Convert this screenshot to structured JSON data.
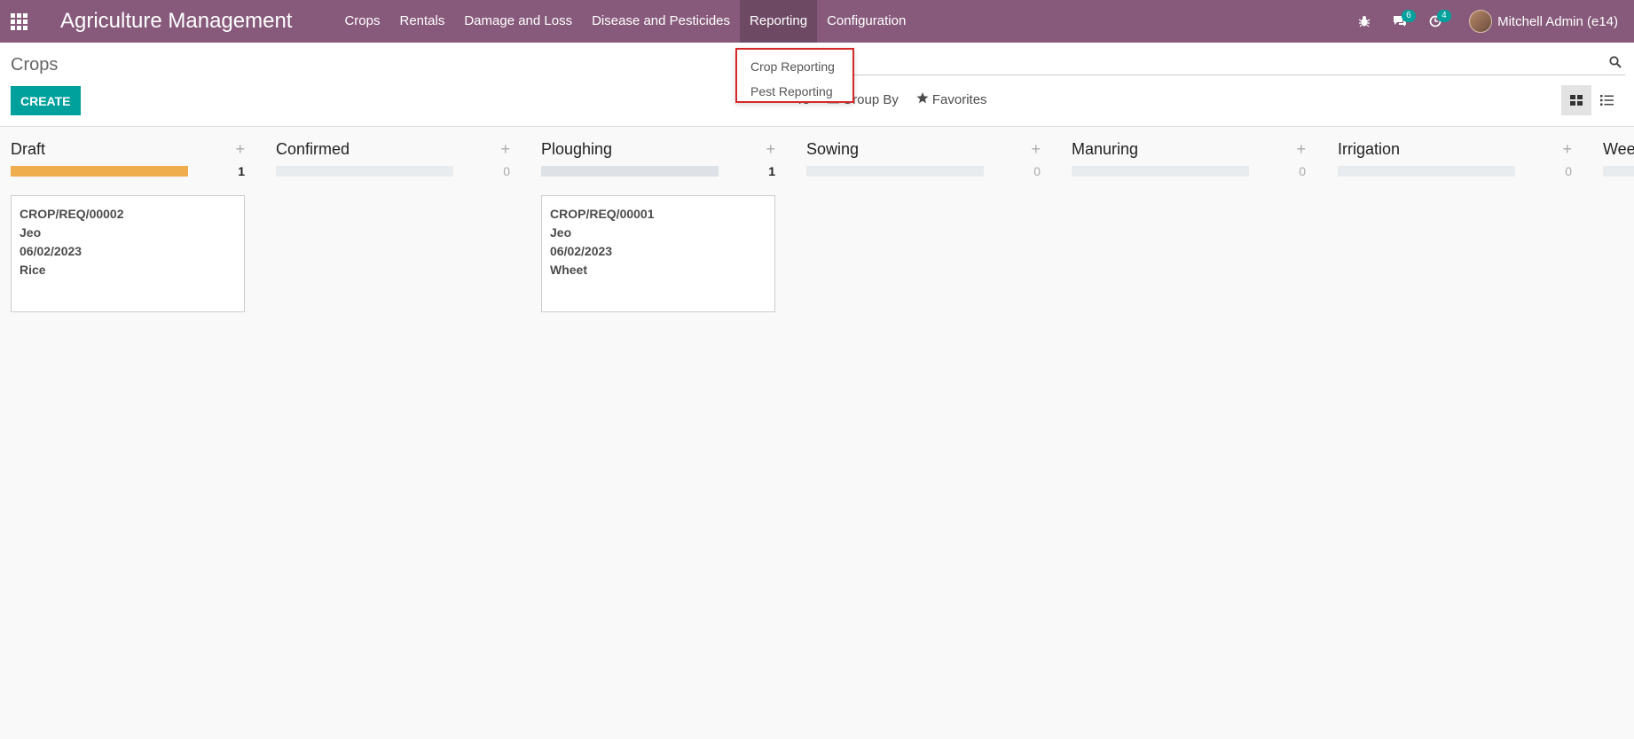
{
  "app": {
    "title": "Agriculture Management"
  },
  "nav": {
    "items": [
      {
        "label": "Crops"
      },
      {
        "label": "Rentals"
      },
      {
        "label": "Damage and Loss"
      },
      {
        "label": "Disease and Pesticides"
      },
      {
        "label": "Reporting"
      },
      {
        "label": "Configuration"
      }
    ],
    "active": "Reporting"
  },
  "system": {
    "messages_count": "6",
    "activities_count": "4",
    "user_name": "Mitchell Admin (e14)"
  },
  "dropdown": {
    "items": [
      {
        "label": "Crop Reporting"
      },
      {
        "label": "Pest Reporting"
      }
    ]
  },
  "control": {
    "breadcrumb": "Crops",
    "create_label": "CREATE",
    "filters_label": "rs",
    "group_by_label": "Group By",
    "favorites_label": "Favorites",
    "search_value": ""
  },
  "colors": {
    "brand": "#875a7b",
    "accent": "#00a09d",
    "draft_progress": "#f0ad4e",
    "empty_progress": "#dee2e6"
  },
  "kanban": {
    "columns": [
      {
        "title": "Draft",
        "count": "1",
        "progress": 1.0,
        "card": {
          "ref": "CROP/REQ/00002",
          "farmer": "Jeo",
          "date": "06/02/2023",
          "crop": "Rice"
        }
      },
      {
        "title": "Confirmed",
        "count": "0",
        "progress": 0
      },
      {
        "title": "Ploughing",
        "count": "1",
        "progress": 1.0,
        "card": {
          "ref": "CROP/REQ/00001",
          "farmer": "Jeo",
          "date": "06/02/2023",
          "crop": "Wheet"
        }
      },
      {
        "title": "Sowing",
        "count": "0",
        "progress": 0
      },
      {
        "title": "Manuring",
        "count": "0",
        "progress": 0
      },
      {
        "title": "Irrigation",
        "count": "0",
        "progress": 0
      },
      {
        "title": "Weed",
        "count": "",
        "progress": 0
      }
    ]
  }
}
